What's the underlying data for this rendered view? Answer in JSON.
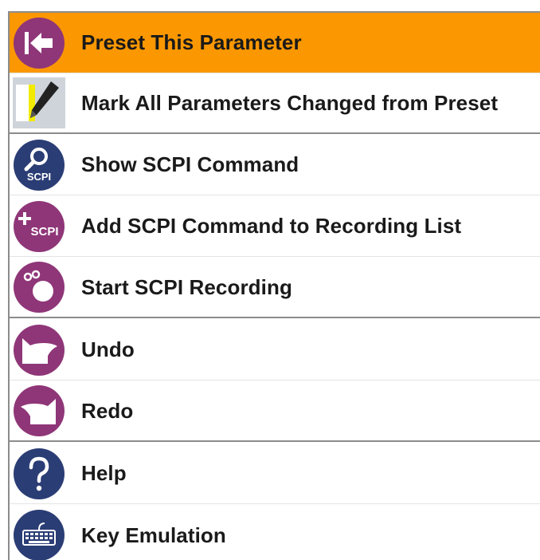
{
  "menu": {
    "items": [
      {
        "label": "Preset This Parameter",
        "icon": "preset-arrow-icon",
        "active": true
      },
      {
        "label": "Mark All Parameters Changed from Preset",
        "icon": "mark-pen-icon"
      },
      {
        "label": "Show SCPI Command",
        "icon": "scpi-search-icon",
        "icon_text": "SCPI"
      },
      {
        "label": "Add SCPI Command to Recording List",
        "icon": "scpi-add-icon",
        "icon_text": "SCPI"
      },
      {
        "label": "Start SCPI Recording",
        "icon": "scpi-record-icon"
      },
      {
        "label": "Undo",
        "icon": "undo-icon"
      },
      {
        "label": "Redo",
        "icon": "redo-icon"
      },
      {
        "label": "Help",
        "icon": "help-icon"
      },
      {
        "label": "Key Emulation",
        "icon": "keyboard-icon"
      }
    ]
  },
  "colors": {
    "active_background": "#fb9700",
    "purple_icon": "#8f3678",
    "navy_icon": "#2b3d75",
    "text": "#1a1a1a"
  }
}
